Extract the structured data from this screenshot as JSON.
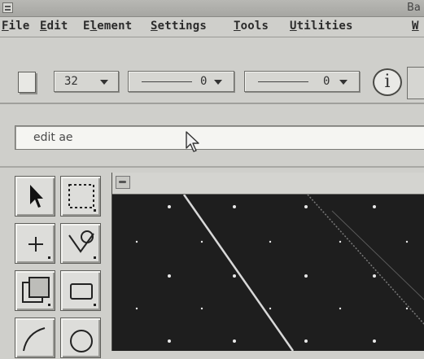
{
  "window": {
    "title_partial": "Ba"
  },
  "menubar": {
    "items": [
      {
        "label": "File",
        "mnemonic": "F",
        "rest": "ile"
      },
      {
        "label": "Edit",
        "mnemonic": "E",
        "rest": "dit"
      },
      {
        "label": "Element",
        "mnemonic": "l",
        "pre": "E",
        "rest": "ement"
      },
      {
        "label": "Settings",
        "mnemonic": "S",
        "rest": "ettings"
      },
      {
        "label": "Tools",
        "mnemonic": "T",
        "rest": "ools"
      },
      {
        "label": "Utilities",
        "mnemonic": "U",
        "rest": "tilities"
      },
      {
        "label": "W",
        "mnemonic": "W",
        "rest": ""
      }
    ]
  },
  "toolbar": {
    "color_value": "32",
    "line_style_value": "0",
    "line_weight_value": "0",
    "info_glyph": "i"
  },
  "command": {
    "text": "edit ae"
  },
  "tools": [
    {
      "name": "select-element-icon"
    },
    {
      "name": "fence-select-icon"
    },
    {
      "name": "place-point-icon"
    },
    {
      "name": "place-smartline-icon"
    },
    {
      "name": "copy-element-icon"
    },
    {
      "name": "place-block-icon"
    },
    {
      "name": "place-arc-icon"
    },
    {
      "name": "place-circle-icon"
    }
  ],
  "colors": {
    "chrome": "#cfcfcb",
    "canvas": "#1e1e1e",
    "grid_dot": "#e8e8e8",
    "element_line": "#d8d8d8"
  }
}
